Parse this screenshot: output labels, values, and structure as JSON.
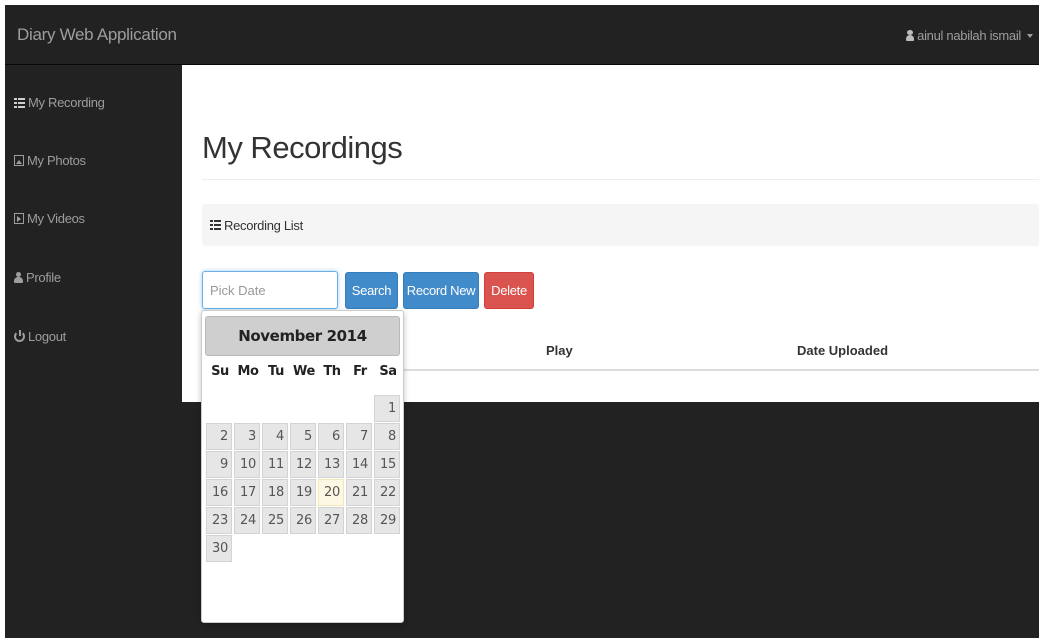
{
  "app": {
    "title": "Diary Web Application"
  },
  "user": {
    "name": "ainul nabilah ismail"
  },
  "sidebar": {
    "items": [
      {
        "label": "My Recording",
        "icon": "list-icon"
      },
      {
        "label": "My Photos",
        "icon": "picture-icon"
      },
      {
        "label": "My Videos",
        "icon": "film-icon"
      },
      {
        "label": "Profile",
        "icon": "user-icon"
      },
      {
        "label": "Logout",
        "icon": "power-icon"
      }
    ]
  },
  "main": {
    "title": "My Recordings",
    "breadcrumb": "Recording List",
    "date_placeholder": "Pick Date",
    "buttons": {
      "search": "Search",
      "record_new": "Record New",
      "delete": "Delete"
    },
    "table_headers": [
      "Play",
      "Date Uploaded"
    ]
  },
  "datepicker": {
    "month_label": "November 2014",
    "weekdays": [
      "Su",
      "Mo",
      "Tu",
      "We",
      "Th",
      "Fr",
      "Sa"
    ],
    "days": [
      [
        "",
        "",
        "",
        "",
        "",
        "",
        "1"
      ],
      [
        "2",
        "3",
        "4",
        "5",
        "6",
        "7",
        "8"
      ],
      [
        "9",
        "10",
        "11",
        "12",
        "13",
        "14",
        "15"
      ],
      [
        "16",
        "17",
        "18",
        "19",
        "20",
        "21",
        "22"
      ],
      [
        "23",
        "24",
        "25",
        "26",
        "27",
        "28",
        "29"
      ],
      [
        "30",
        "",
        "",
        "",
        "",
        "",
        ""
      ]
    ],
    "highlighted_day": "20"
  },
  "colors": {
    "primary": "#428bca",
    "danger": "#d9534f",
    "navbar": "#222222",
    "today": "#fcf8e3"
  }
}
